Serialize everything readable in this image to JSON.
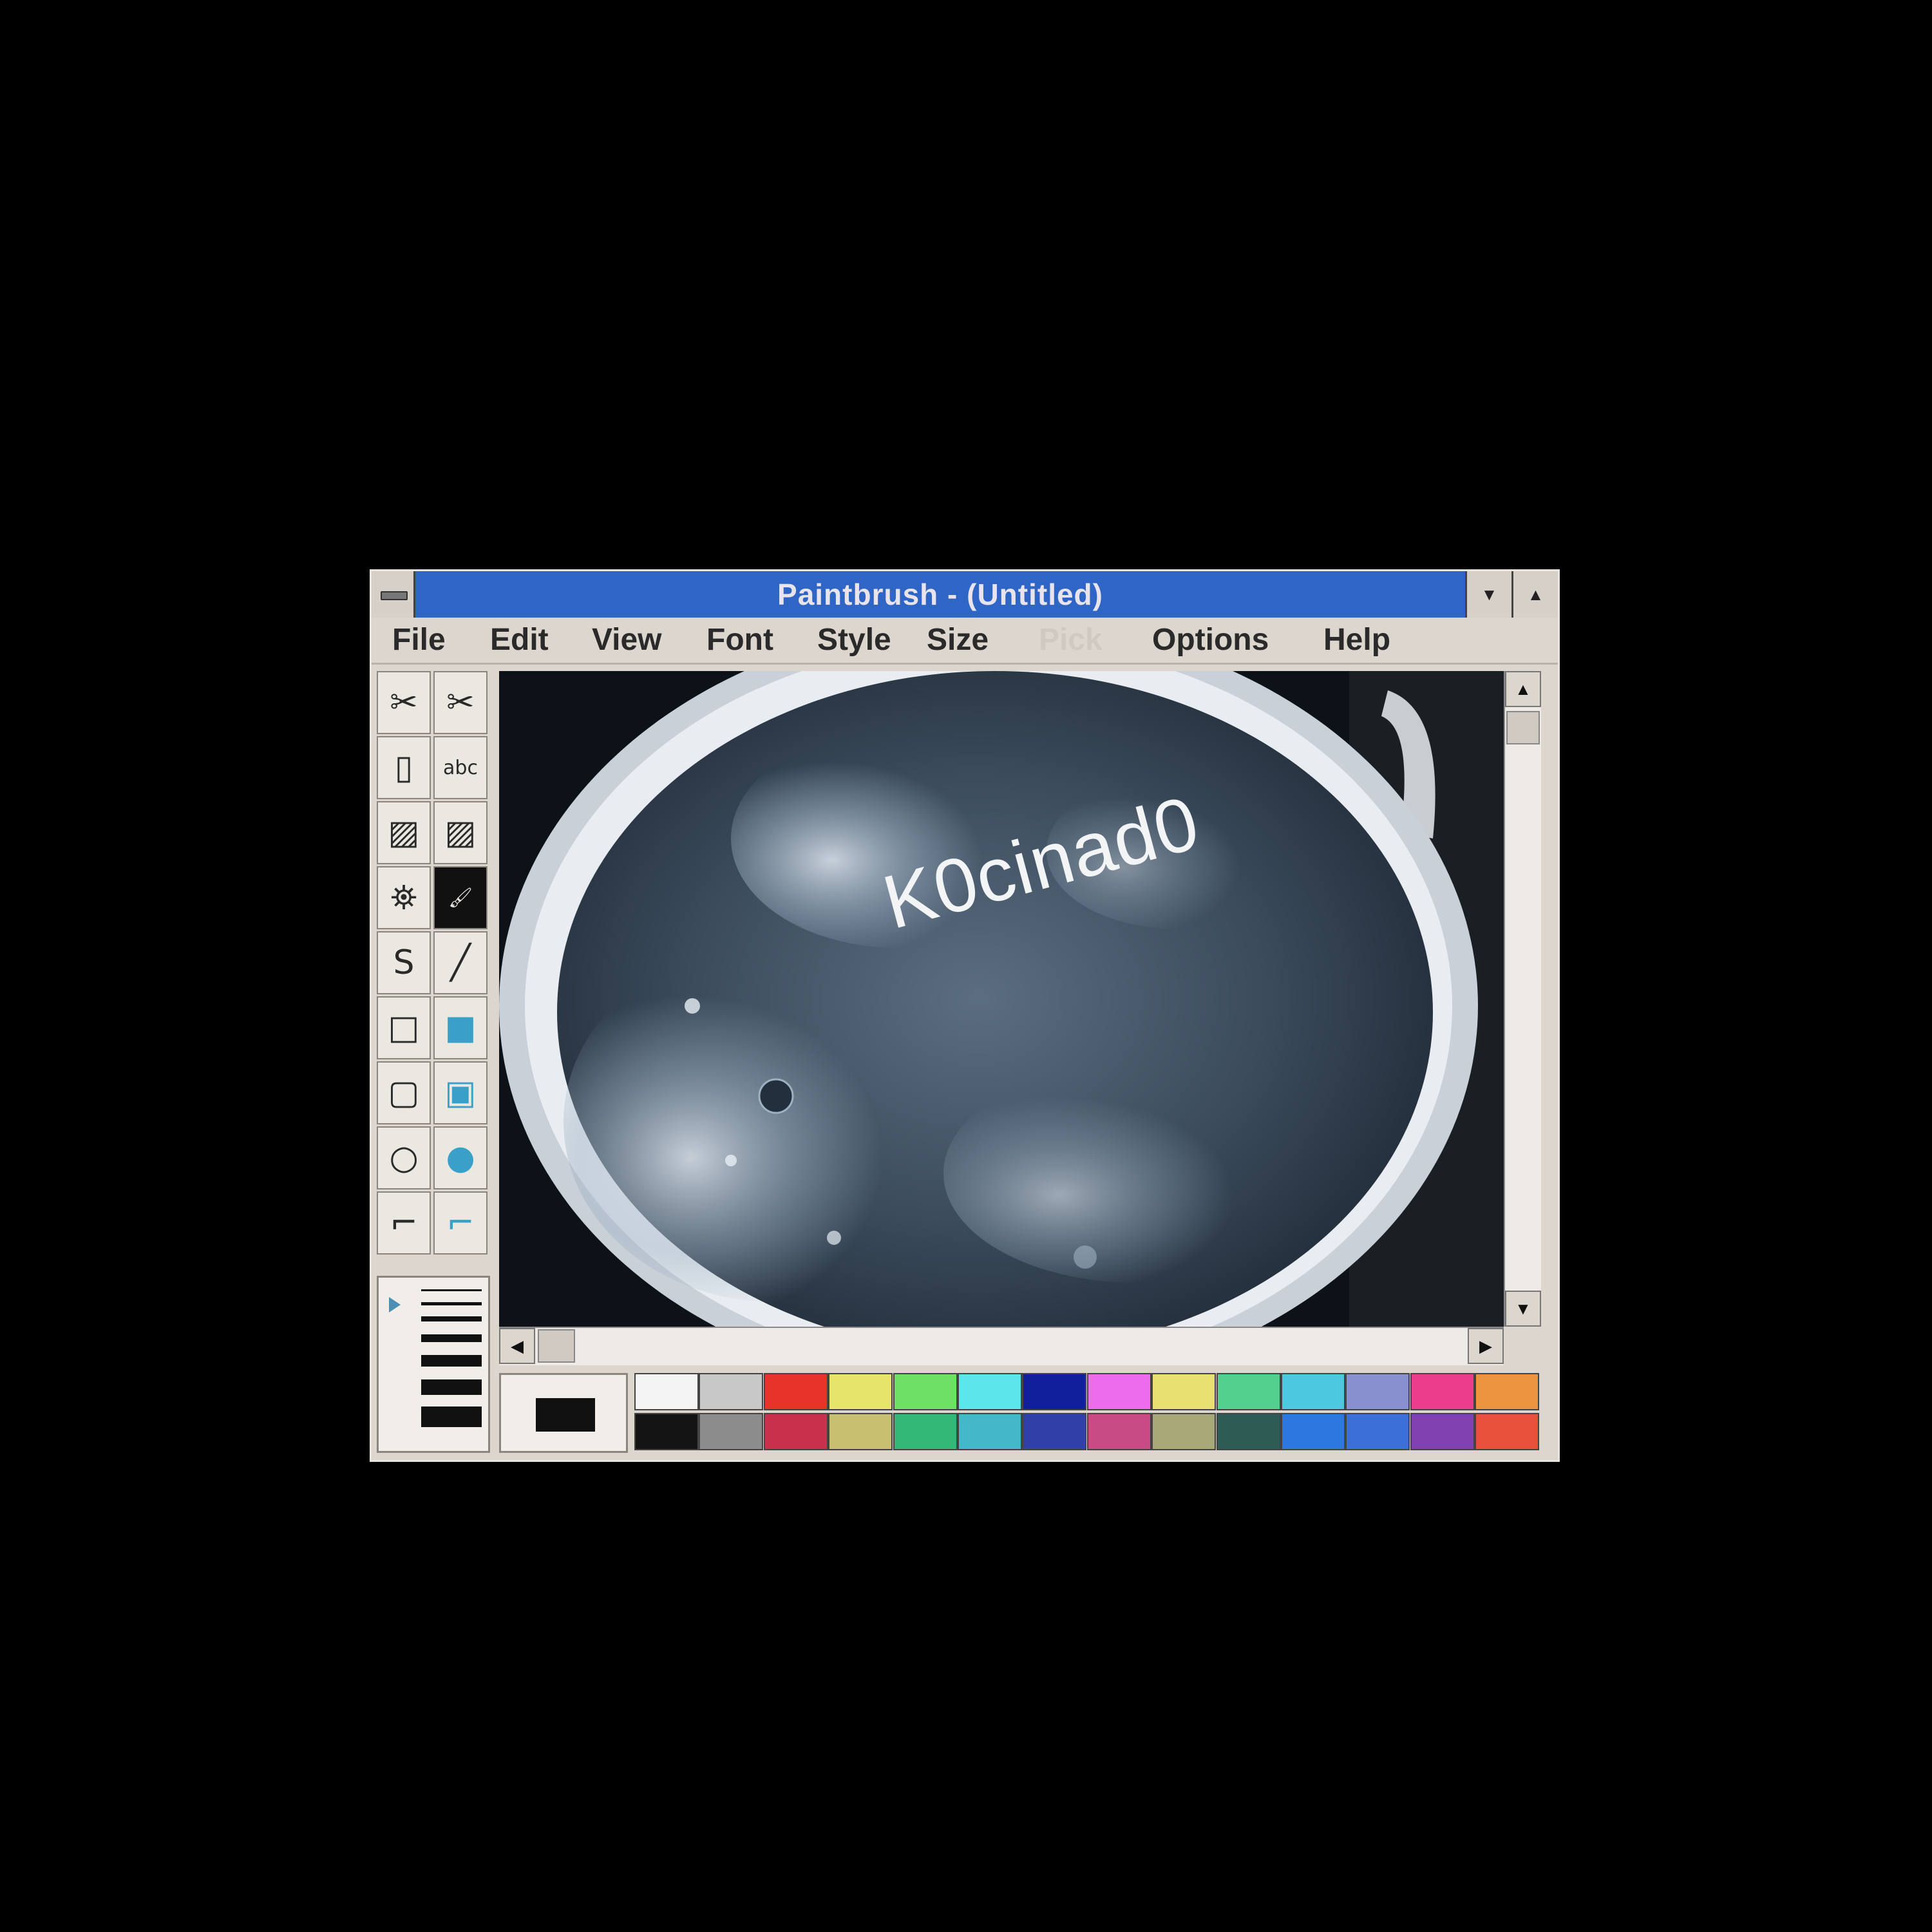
{
  "window": {
    "title": "Paintbrush - (Untitled)",
    "min_glyph": "▼",
    "max_glyph": "▲"
  },
  "menu": [
    {
      "label": "File",
      "enabled": true
    },
    {
      "label": "Edit",
      "enabled": true
    },
    {
      "label": "View",
      "enabled": true
    },
    {
      "label": "Font",
      "enabled": true
    },
    {
      "label": "Style",
      "enabled": true
    },
    {
      "label": "Size",
      "enabled": true
    },
    {
      "label": "Pick",
      "enabled": false
    },
    {
      "label": "Options",
      "enabled": true
    },
    {
      "label": "Help",
      "enabled": true
    }
  ],
  "tools": [
    {
      "name": "scissors-icon",
      "glyph": "✂",
      "selected": false
    },
    {
      "name": "pick-scissors-icon",
      "glyph": "✂",
      "selected": false
    },
    {
      "name": "airbrush-icon",
      "glyph": "▯",
      "selected": false
    },
    {
      "name": "text-tool-icon",
      "glyph": "abc",
      "selected": false
    },
    {
      "name": "color-eraser-icon",
      "glyph": "▨",
      "selected": false
    },
    {
      "name": "eraser-icon",
      "glyph": "▨",
      "selected": false
    },
    {
      "name": "paint-roller-icon",
      "glyph": "⛯",
      "selected": false
    },
    {
      "name": "brush-icon",
      "glyph": "🖌",
      "selected": true
    },
    {
      "name": "curve-icon",
      "glyph": "S",
      "selected": false
    },
    {
      "name": "line-icon",
      "glyph": "╱",
      "selected": false
    },
    {
      "name": "box-icon",
      "glyph": "□",
      "selected": false
    },
    {
      "name": "filled-box-icon",
      "glyph": "■",
      "selected": false
    },
    {
      "name": "rounded-box-icon",
      "glyph": "▢",
      "selected": false
    },
    {
      "name": "filled-rounded-box-icon",
      "glyph": "▣",
      "selected": false
    },
    {
      "name": "circle-icon",
      "glyph": "○",
      "selected": false
    },
    {
      "name": "filled-circle-icon",
      "glyph": "●",
      "selected": false
    },
    {
      "name": "polygon-icon",
      "glyph": "⌐",
      "selected": false
    },
    {
      "name": "filled-polygon-icon",
      "glyph": "⌐",
      "selected": false
    }
  ],
  "canvas": {
    "watermark": "K0cinad0"
  },
  "palette": {
    "current_color": "#111111",
    "top": [
      "#f4f4f4",
      "#c8c8c8",
      "#e8332a",
      "#e6e46a",
      "#6ee066",
      "#5ce6ec",
      "#10209c",
      "#ec6cec",
      "#e8e070",
      "#52d08c",
      "#4cc8e0",
      "#8890d0",
      "#ec3c8c",
      "#ec9440"
    ],
    "bottom": [
      "#141414",
      "#8c8c8c",
      "#c8304c",
      "#c8c070",
      "#34b878",
      "#44b8c8",
      "#3040a8",
      "#c84c84",
      "#a8a878",
      "#2c5c54",
      "#2c78e0",
      "#3c70d8",
      "#8040b0",
      "#e8503c"
    ]
  }
}
